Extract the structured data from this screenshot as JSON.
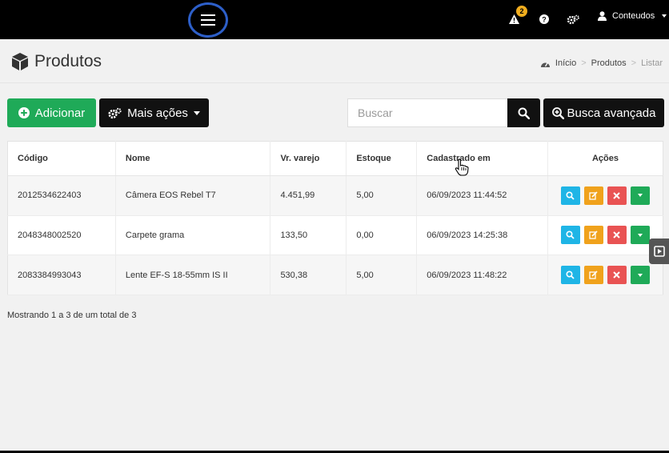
{
  "topbar": {
    "notification_count": "2",
    "user_name": "Conteudos"
  },
  "page": {
    "title": "Produtos"
  },
  "breadcrumb": {
    "items": [
      "Início",
      "Produtos",
      "Listar"
    ]
  },
  "toolbar": {
    "add_label": "Adicionar",
    "more_actions_label": "Mais ações",
    "search_placeholder": "Buscar",
    "advanced_search_label": "Busca avançada"
  },
  "table": {
    "columns": [
      "Código",
      "Nome",
      "Vr. varejo",
      "Estoque",
      "Cadastrado em",
      "Ações"
    ],
    "rows": [
      {
        "codigo": "2012534622403",
        "nome": "Câmera EOS Rebel T7",
        "varejo": "4.451,99",
        "estoque": "5,00",
        "cadastrado": "06/09/2023 11:44:52"
      },
      {
        "codigo": "2048348002520",
        "nome": "Carpete grama",
        "varejo": "133,50",
        "estoque": "0,00",
        "cadastrado": "06/09/2023 14:25:38"
      },
      {
        "codigo": "2083384993043",
        "nome": "Lente EF-S 18-55mm IS II",
        "varejo": "530,38",
        "estoque": "5,00",
        "cadastrado": "06/09/2023 11:48:22"
      }
    ]
  },
  "pagination": {
    "summary": "Mostrando 1 a 3 de um total de 3"
  },
  "colors": {
    "topbar": "#000000",
    "add_button": "#1faa58",
    "view_button": "#1fb5e6",
    "edit_button": "#f0a21c",
    "delete_button": "#e95353",
    "highlight_ring": "#2d5fc9"
  }
}
